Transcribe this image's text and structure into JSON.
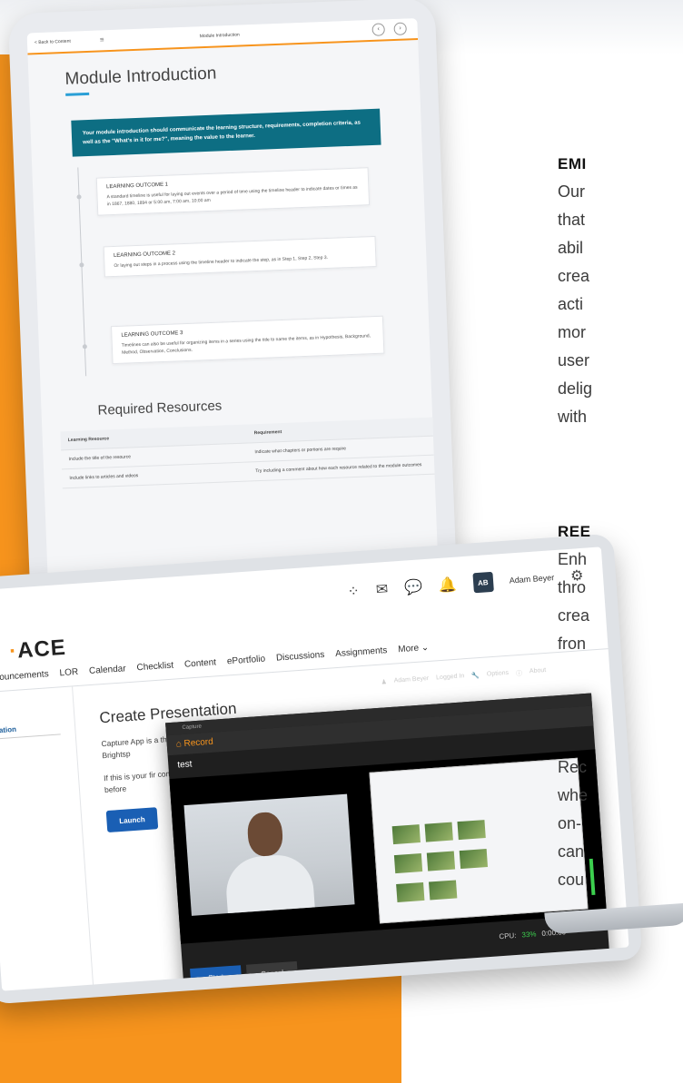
{
  "colors": {
    "accent": "#f7941d",
    "brand_blue": "#1a5fb4",
    "teal": "#0d6e83"
  },
  "tablet": {
    "back_label": "< Back to Content",
    "page_label": "Module Introduction",
    "title": "Module Introduction",
    "banner": "Your module introduction should communicate the learning structure, requirements, completion criteria, as well as the \"What's in it for me?\", meaning the value to the learner.",
    "outcomes": [
      {
        "title": "LEARNING OUTCOME 1",
        "text": "A standard timeline is useful for laying out events over a period of time using the timeline header to indicate dates or times as in 1867, 1880, 1894 or 5:00 am, 7:00 am, 10:00 am"
      },
      {
        "title": "LEARNING OUTCOME 2",
        "text": "Or laying out steps in a process using the timeline header to indicate the step, as in Step 1, Step 2, Step 3."
      },
      {
        "title": "LEARNING OUTCOME 3",
        "text": "Timelines can also be useful for organizing items in a series using the title to name the items, as in Hypothesis, Background, Method, Observation, Conclusions."
      }
    ],
    "resources_title": "Required Resources",
    "table": {
      "headers": [
        "Learning Resource",
        "Requirement"
      ],
      "rows": [
        [
          "Include the title of the resource",
          "Indicate what chapters or portions are require"
        ],
        [
          "Include links to articles and videos",
          "Try including a comment about how each resource related to the module outcomes"
        ]
      ]
    }
  },
  "laptop": {
    "icons": [
      "waffle-icon",
      "mail-icon",
      "chat-icon",
      "bell-icon",
      "gear-icon"
    ],
    "avatar": "AB",
    "user_name": "Adam Beyer",
    "logo": "ACE",
    "logo_prefix": "·",
    "nav": [
      "nnouncements",
      "LOR",
      "Calendar",
      "Checklist",
      "Content",
      "ePortfolio",
      "Discussions",
      "Assignments",
      "More"
    ],
    "sidebar_item": "tation",
    "heading": "Create Presentation",
    "para1": "Capture App is a them to Brightsp",
    "para2": "If this is your fir computer before",
    "launch": "Launch",
    "top_bar": {
      "user": "Adam Beyer",
      "logged_in": "Logged In",
      "options": "Options",
      "about": "About"
    },
    "capture": {
      "window_title": "Capture",
      "record_label": "Record",
      "recording_name": "test",
      "cpu_label": "CPU:",
      "cpu_value": "33%",
      "timer": "0:00:00",
      "start": "Start",
      "cancel": "Cancel"
    }
  },
  "right": {
    "heading1": "EMI",
    "lines1": [
      "Our",
      "that",
      "abil",
      "crea",
      "acti",
      "mor",
      "user",
      "delig",
      "with"
    ],
    "heading2": "REE",
    "lines2": [
      "Enh",
      "thro",
      "crea",
      "fron"
    ],
    "lines3": [
      "Rec",
      "whe",
      "on-",
      "can",
      "cou"
    ]
  }
}
